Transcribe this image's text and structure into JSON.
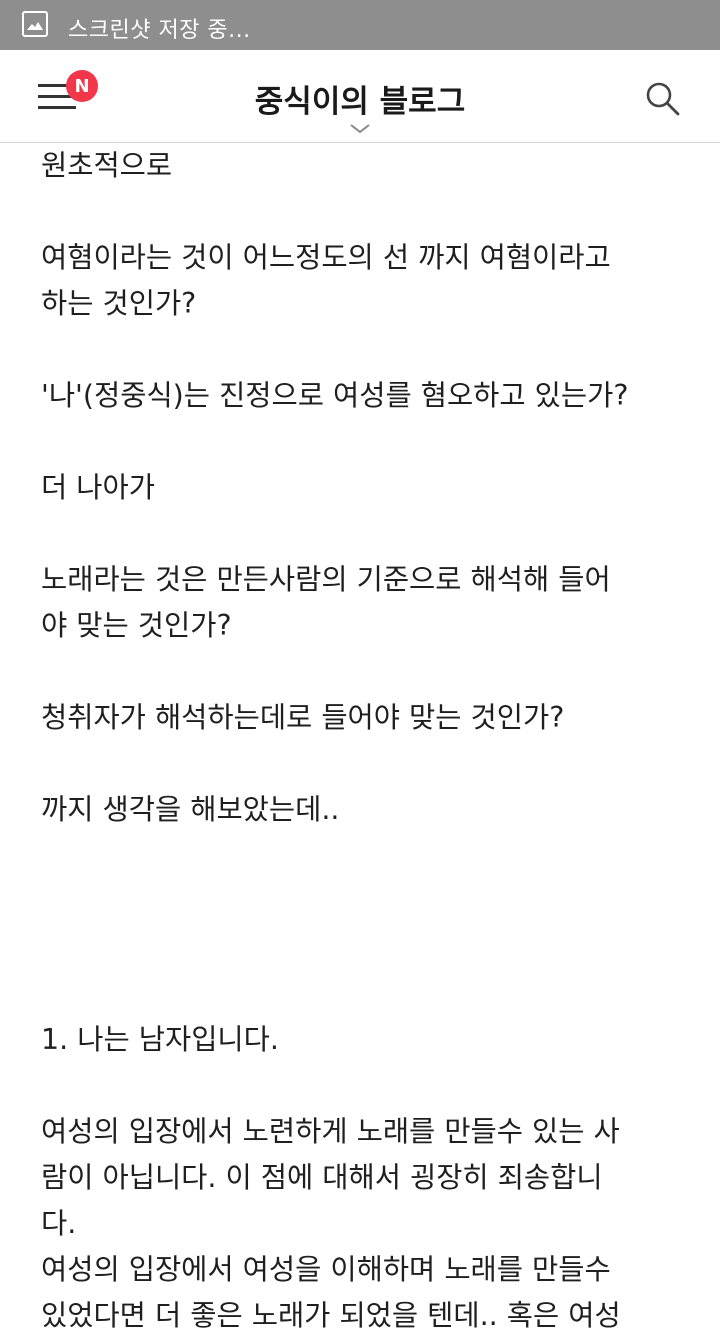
{
  "status_bar": {
    "icon": "image-icon",
    "text": "스크린샷 저장 중..."
  },
  "header": {
    "menu_icon": "hamburger-menu-icon",
    "badge": "N",
    "title": "중식이의 블로그",
    "dropdown_icon": "chevron-down-icon",
    "search_icon": "search-icon"
  },
  "post": {
    "lines": [
      "원초적으로",
      "",
      "여혐이라는 것이 어느정도의 선 까지 여혐이라고",
      "하는 것인가?",
      "",
      "'나'(정중식)는 진정으로 여성를 혐오하고 있는가?",
      "",
      "더 나아가",
      "",
      "노래라는 것은 만든사람의 기준으로 해석해 들어",
      "야 맞는 것인가?",
      "",
      "청취자가 해석하는데로 들어야 맞는 것인가?",
      "",
      "까지 생각을 해보았는데..",
      "",
      "",
      "",
      "",
      "1. 나는 남자입니다.",
      "",
      "여성의 입장에서 노련하게 노래를 만들수 있는 사",
      "람이 아닙니다. 이 점에 대해서 굉장히 죄송합니",
      "다.",
      "여성의 입장에서 여성을 이해하며 노래를 만들수",
      "있었다면 더 좋은 노래가 되었을 텐데.. 혹은 여성"
    ]
  }
}
